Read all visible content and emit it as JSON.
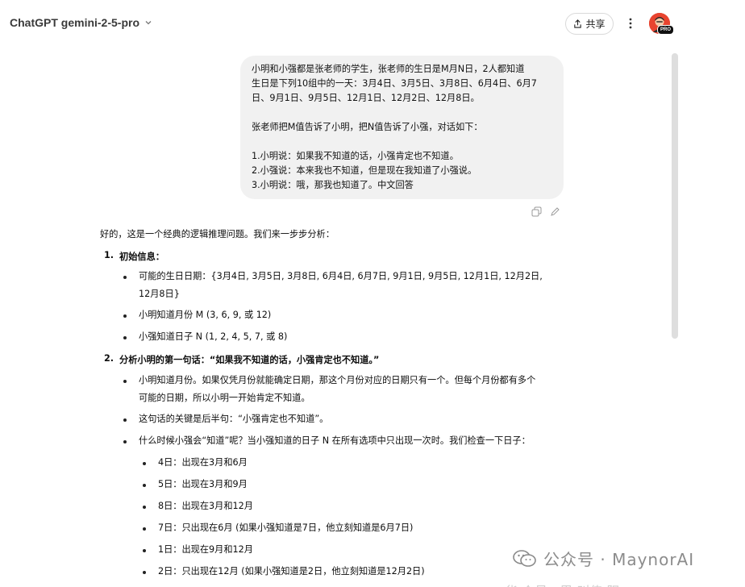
{
  "header": {
    "model_name": "ChatGPT gemini-2-5-pro",
    "share_label": "共享",
    "avatar_badge": "PRO",
    "icons": [
      "chevron-down-icon",
      "share-icon",
      "more-vertical-icon"
    ]
  },
  "user_message": {
    "para1": "小明和小强都是张老师的学生，张老师的生日是M月N日，2人都知道\n生日是下列10组中的一天：3月4日、3月5日、3月8日、6月4日、6月7\n日、9月1日、9月5日、12月1日、12月2日、12月8日。",
    "para2": "张老师把M值告诉了小明，把N值告诉了小强，对话如下：",
    "para3": "1.小明说：如果我不知道的话，小强肯定也不知道。\n2.小强说：本来我也不知道，但是现在我知道了小强说。\n3.小明说：哦，那我也知道了。中文回答"
  },
  "assistant": {
    "intro": "好的，这是一个经典的逻辑推理问题。我们来一步步分析：",
    "sections": [
      {
        "number": "1.",
        "title": "初始信息：",
        "bullets": [
          "可能的生日日期：{3月4日, 3月5日, 3月8日, 6月4日, 6月7日, 9月1日, 9月5日, 12月1日, 12月2日,",
          "12月8日}",
          "小明知道月份 M (3, 6, 9, 或 12)",
          "小强知道日子 N (1, 2, 4, 5, 7, 或 8)"
        ]
      },
      {
        "number": "2.",
        "title": "分析小明的第一句话：“如果我不知道的话，小强肯定也不知道。”",
        "bullets": [
          "小明知道月份。如果仅凭月份就能确定日期，那这个月份对应的日期只有一个。但每个月份都有多个",
          "可能的日期，所以小明一开始肯定不知道。",
          "这句话的关键是后半句：“小强肯定也不知道”。",
          "什么时候小强会“知道”呢？当小强知道的日子 N 在所有选项中只出现一次时。我们检查一下日子："
        ],
        "sub_bullets": [
          "4日：出现在3月和6月",
          "5日：出现在3月和9月",
          "8日：出现在3月和12月",
          "7日：只出现在6月 (如果小强知道是7日，他立刻知道是6月7日)",
          "1日：出现在9月和12月",
          "2日：只出现在12月 (如果小强知道是2日，他立刻知道是12月2日)"
        ]
      }
    ]
  },
  "watermark": {
    "text": "公众号 · MaynorAI",
    "partial_text": "华 介号 · 思 叫传 阳"
  }
}
